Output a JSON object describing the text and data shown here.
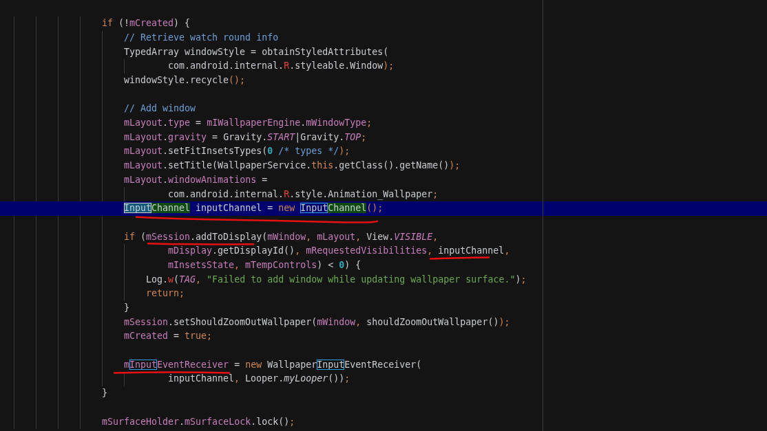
{
  "editor": {
    "lines": [
      {
        "kind": "outer",
        "selected": false,
        "tokens": [
          {
            "text": "if",
            "kind": "kw"
          },
          {
            "text": " (!"
          },
          {
            "text": "mCreated",
            "kind": "field"
          },
          {
            "text": ") {"
          }
        ]
      },
      {
        "kind": "body",
        "selected": false,
        "tokens": [
          {
            "text": "// Retrieve watch round info",
            "kind": "comment"
          }
        ]
      },
      {
        "kind": "body",
        "selected": false,
        "tokens": [
          {
            "text": "TypedArray windowStyle = obtainStyledAttributes("
          }
        ]
      },
      {
        "kind": "wrap",
        "selected": false,
        "tokens": [
          {
            "text": "com.android.internal."
          },
          {
            "text": "R",
            "kind": "red"
          },
          {
            "text": ".styleable.Window"
          },
          {
            "text": ");",
            "kind": "punc"
          }
        ]
      },
      {
        "kind": "body",
        "selected": false,
        "tokens": [
          {
            "text": "windowStyle.recycle"
          },
          {
            "text": "();",
            "kind": "punc"
          }
        ]
      },
      {
        "kind": "blank",
        "selected": false
      },
      {
        "kind": "body",
        "selected": false,
        "tokens": [
          {
            "text": "// Add window",
            "kind": "comment"
          }
        ]
      },
      {
        "kind": "body",
        "selected": false,
        "tokens": [
          {
            "text": "mLayout",
            "kind": "field"
          },
          {
            "text": "."
          },
          {
            "text": "type",
            "kind": "field"
          },
          {
            "text": " = "
          },
          {
            "text": "mIWallpaperEngine",
            "kind": "field"
          },
          {
            "text": "."
          },
          {
            "text": "mWindowType",
            "kind": "field"
          },
          {
            "text": ";",
            "kind": "punc"
          }
        ]
      },
      {
        "kind": "body",
        "selected": false,
        "tokens": [
          {
            "text": "mLayout",
            "kind": "field"
          },
          {
            "text": "."
          },
          {
            "text": "gravity",
            "kind": "field"
          },
          {
            "text": " = Gravity."
          },
          {
            "text": "START",
            "kind": "fieldi"
          },
          {
            "text": "|Gravity."
          },
          {
            "text": "TOP",
            "kind": "fieldi"
          },
          {
            "text": ";",
            "kind": "punc"
          }
        ]
      },
      {
        "kind": "body",
        "selected": false,
        "tokens": [
          {
            "text": "mLayout",
            "kind": "field"
          },
          {
            "text": ".setFitInsetsTypes("
          },
          {
            "text": "0",
            "kind": "num"
          },
          {
            "text": " /* types */",
            "kind": "comment"
          },
          {
            "text": ");",
            "kind": "punc"
          }
        ]
      },
      {
        "kind": "body",
        "selected": false,
        "tokens": [
          {
            "text": "mLayout",
            "kind": "field"
          },
          {
            "text": ".setTitle(WallpaperService."
          },
          {
            "text": "this",
            "kind": "kw"
          },
          {
            "text": ".getClass().getName()"
          },
          {
            "text": ");",
            "kind": "punc"
          }
        ]
      },
      {
        "kind": "body",
        "selected": false,
        "tokens": [
          {
            "text": "mLayout",
            "kind": "field"
          },
          {
            "text": "."
          },
          {
            "text": "windowAnimations",
            "kind": "field"
          },
          {
            "text": " ="
          }
        ]
      },
      {
        "kind": "wrap",
        "selected": false,
        "tokens": [
          {
            "text": "com.android.internal."
          },
          {
            "text": "R",
            "kind": "red"
          },
          {
            "text": ".style.Animation_Wallpaper"
          },
          {
            "text": ";",
            "kind": "punc"
          }
        ]
      },
      {
        "kind": "body",
        "selected": true,
        "tokens": [
          {
            "text": "Input",
            "boxed": true,
            "current": true
          },
          {
            "text": "Channel",
            "matched": true
          },
          {
            "text": " inputChannel = "
          },
          {
            "text": "new ",
            "kind": "kw"
          },
          {
            "text": "Input",
            "boxed": true
          },
          {
            "text": "Channel",
            "matched": true
          },
          {
            "text": "();",
            "kind": "punc"
          }
        ]
      },
      {
        "kind": "blank",
        "selected": false
      },
      {
        "kind": "body",
        "selected": false,
        "tokens": [
          {
            "text": "if",
            "kind": "kw"
          },
          {
            "text": " ("
          },
          {
            "text": "mSession",
            "kind": "field"
          },
          {
            "text": ".addToDisplay("
          },
          {
            "text": "mWindow",
            "kind": "field"
          },
          {
            "text": ", ",
            "kind": "punc"
          },
          {
            "text": "mLayout",
            "kind": "field"
          },
          {
            "text": ", ",
            "kind": "punc"
          },
          {
            "text": "View."
          },
          {
            "text": "VISIBLE",
            "kind": "fieldi"
          },
          {
            "text": ",",
            "kind": "punc"
          }
        ]
      },
      {
        "kind": "wrap",
        "selected": false,
        "tokens": [
          {
            "text": "mDisplay",
            "kind": "field"
          },
          {
            "text": ".getDisplayId()"
          },
          {
            "text": ", ",
            "kind": "punc"
          },
          {
            "text": "mRequestedVisibilities",
            "kind": "field"
          },
          {
            "text": ", ",
            "kind": "punc"
          },
          {
            "text": "inputChannel"
          },
          {
            "text": ",",
            "kind": "punc"
          }
        ]
      },
      {
        "kind": "wrap",
        "selected": false,
        "tokens": [
          {
            "text": "mInsetsState",
            "kind": "field"
          },
          {
            "text": ", ",
            "kind": "punc"
          },
          {
            "text": "mTempControls",
            "kind": "field"
          },
          {
            "text": ") < "
          },
          {
            "text": "0",
            "kind": "num"
          },
          {
            "text": ") {"
          }
        ]
      },
      {
        "kind": "inner",
        "selected": false,
        "tokens": [
          {
            "text": "Log."
          },
          {
            "text": "w",
            "kind": "red"
          },
          {
            "text": "("
          },
          {
            "text": "TAG",
            "kind": "fieldi"
          },
          {
            "text": ", ",
            "kind": "punc"
          },
          {
            "text": "\"Failed to add window while updating wallpaper surface.\"",
            "kind": "str"
          },
          {
            "text": ")"
          },
          {
            "text": ";",
            "kind": "punc"
          }
        ]
      },
      {
        "kind": "inner",
        "selected": false,
        "tokens": [
          {
            "text": "return;",
            "kind": "kw"
          }
        ]
      },
      {
        "kind": "body",
        "selected": false,
        "tokens": [
          {
            "text": "}"
          }
        ]
      },
      {
        "kind": "body",
        "selected": false,
        "tokens": [
          {
            "text": "mSession",
            "kind": "field"
          },
          {
            "text": ".setShouldZoomOutWallpaper("
          },
          {
            "text": "mWindow",
            "kind": "field"
          },
          {
            "text": ", ",
            "kind": "punc"
          },
          {
            "text": "shouldZoomOutWallpaper()"
          },
          {
            "text": ");",
            "kind": "punc"
          }
        ]
      },
      {
        "kind": "body",
        "selected": false,
        "tokens": [
          {
            "text": "mCreated",
            "kind": "field"
          },
          {
            "text": " = "
          },
          {
            "text": "true;",
            "kind": "kw"
          }
        ]
      },
      {
        "kind": "blank",
        "selected": false
      },
      {
        "kind": "body",
        "selected": false,
        "tokens": [
          {
            "text": "m",
            "kind": "field"
          },
          {
            "text": "Input",
            "kind": "field",
            "boxed": true
          },
          {
            "text": "EventReceiver",
            "kind": "field"
          },
          {
            "text": " = "
          },
          {
            "text": "new",
            "kind": "kw"
          },
          {
            "text": " Wallpaper"
          },
          {
            "text": "Input",
            "boxed": true
          },
          {
            "text": "EventReceiver("
          }
        ]
      },
      {
        "kind": "wrap",
        "selected": false,
        "tokens": [
          {
            "text": "inputChannel"
          },
          {
            "text": ", ",
            "kind": "punc"
          },
          {
            "text": "Looper."
          },
          {
            "text": "myLooper",
            "kind": "mi"
          },
          {
            "text": "())"
          },
          {
            "text": ";",
            "kind": "punc"
          }
        ]
      },
      {
        "kind": "outer",
        "selected": false,
        "tokens": [
          {
            "text": "}"
          }
        ]
      },
      {
        "kind": "blank",
        "selected": false
      },
      {
        "kind": "outer",
        "selected": false,
        "tokens": [
          {
            "text": "mSurfaceHolder",
            "kind": "field"
          },
          {
            "text": "."
          },
          {
            "text": "mSurfaceLock",
            "kind": "field"
          },
          {
            "text": ".lock()"
          },
          {
            "text": ";",
            "kind": "punc"
          }
        ]
      }
    ]
  }
}
